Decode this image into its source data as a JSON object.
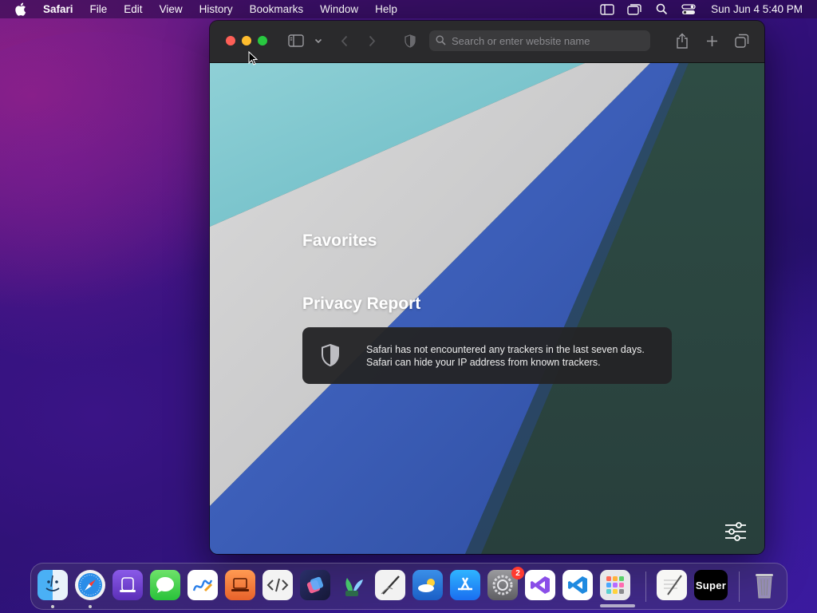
{
  "menubar": {
    "app_name": "Safari",
    "menus": [
      "File",
      "Edit",
      "View",
      "History",
      "Bookmarks",
      "Window",
      "Help"
    ],
    "status_icons": [
      "display-icon",
      "screen-mirror-icon",
      "spotlight-search-icon",
      "control-center-icon"
    ],
    "datetime": "Sun Jun 4  5:40 PM"
  },
  "toolbar": {
    "address_placeholder": "Search or enter website name",
    "buttons": [
      "sidebar-toggle-icon",
      "chevron-down-icon",
      "back-icon",
      "forward-icon",
      "privacy-shield-icon",
      "share-icon",
      "new-tab-icon",
      "tab-overview-icon"
    ]
  },
  "start_page": {
    "favorites_title": "Favorites",
    "privacy_title": "Privacy Report",
    "privacy_message": "Safari has not encountered any trackers in the last seven days. Safari can hide your IP address from known trackers."
  },
  "dock": {
    "apps": [
      {
        "name": "Finder",
        "icon": "finder-icon",
        "running": true
      },
      {
        "name": "Safari",
        "icon": "safari-icon",
        "running": true
      },
      {
        "name": "Apple Configurator",
        "icon": "configurator-icon"
      },
      {
        "name": "Messages",
        "icon": "messages-icon"
      },
      {
        "name": "Freeform",
        "icon": "freeform-icon"
      },
      {
        "name": "Laptop App",
        "icon": "laptop-icon"
      },
      {
        "name": "Script Editor",
        "icon": "code-icon"
      },
      {
        "name": "Shortcuts",
        "icon": "shortcuts-icon"
      },
      {
        "name": "Maps Plus",
        "icon": "plant-icon"
      },
      {
        "name": "Pen Tool",
        "icon": "pen-icon"
      },
      {
        "name": "Weather",
        "icon": "weather-icon"
      },
      {
        "name": "App Store",
        "icon": "app-store-icon"
      },
      {
        "name": "System Settings",
        "icon": "settings-icon",
        "badge": "2"
      },
      {
        "name": "Visual Studio",
        "icon": "visual-studio-icon"
      },
      {
        "name": "VS Code",
        "icon": "vscode-icon"
      },
      {
        "name": "Launchpad",
        "icon": "launchpad-icon"
      },
      {
        "name": "TextEdit",
        "icon": "textedit-icon"
      },
      {
        "name": "Super",
        "icon": "super-icon",
        "label": "Super"
      },
      {
        "name": "Trash",
        "icon": "trash-icon"
      }
    ]
  },
  "colors": {
    "close": "#fe5f57",
    "minimize": "#febc2e",
    "maximize": "#28c840",
    "badge": "#ff3b30"
  }
}
